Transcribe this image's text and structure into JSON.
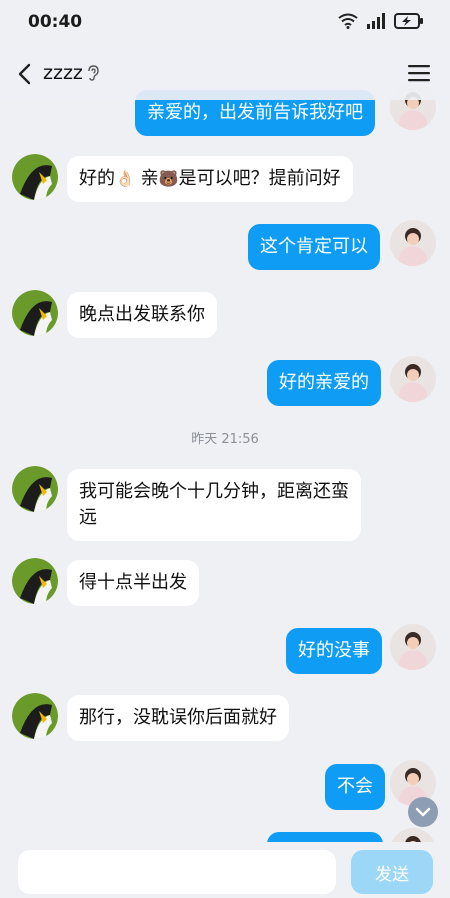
{
  "status": {
    "time": "00:40"
  },
  "header": {
    "title": "zzzz"
  },
  "messages": [
    {
      "dir": "out",
      "text": "亲爱的，出发前告诉我好吧"
    },
    {
      "dir": "in",
      "text_a": "好的",
      "emoji_a": "👌🏻",
      "text_b": " 亲",
      "emoji_b": "🐻",
      "text_c": "是可以吧？提前问好"
    },
    {
      "dir": "out",
      "text": "这个肯定可以"
    },
    {
      "dir": "in",
      "text": "晚点出发联系你"
    },
    {
      "dir": "out",
      "text": "好的亲爱的"
    },
    {
      "dir": "in",
      "line1": "我可能会晚个十几分钟，距离还蛮",
      "line2": "远"
    },
    {
      "dir": "in",
      "text": "得十点半出发"
    },
    {
      "dir": "out",
      "text": "好的没事"
    },
    {
      "dir": "in",
      "text": "那行，没耽误你后面就好"
    },
    {
      "dir": "out",
      "text": "不会"
    }
  ],
  "divider": {
    "label": "昨天 21:56"
  },
  "input": {
    "value": "",
    "placeholder": ""
  },
  "send_button": {
    "label": "发送"
  },
  "colors": {
    "outgoing": "#0f9cf5",
    "incoming": "#ffffff",
    "send_disabled": "#9dd7f8",
    "background": "#eef0f4"
  }
}
